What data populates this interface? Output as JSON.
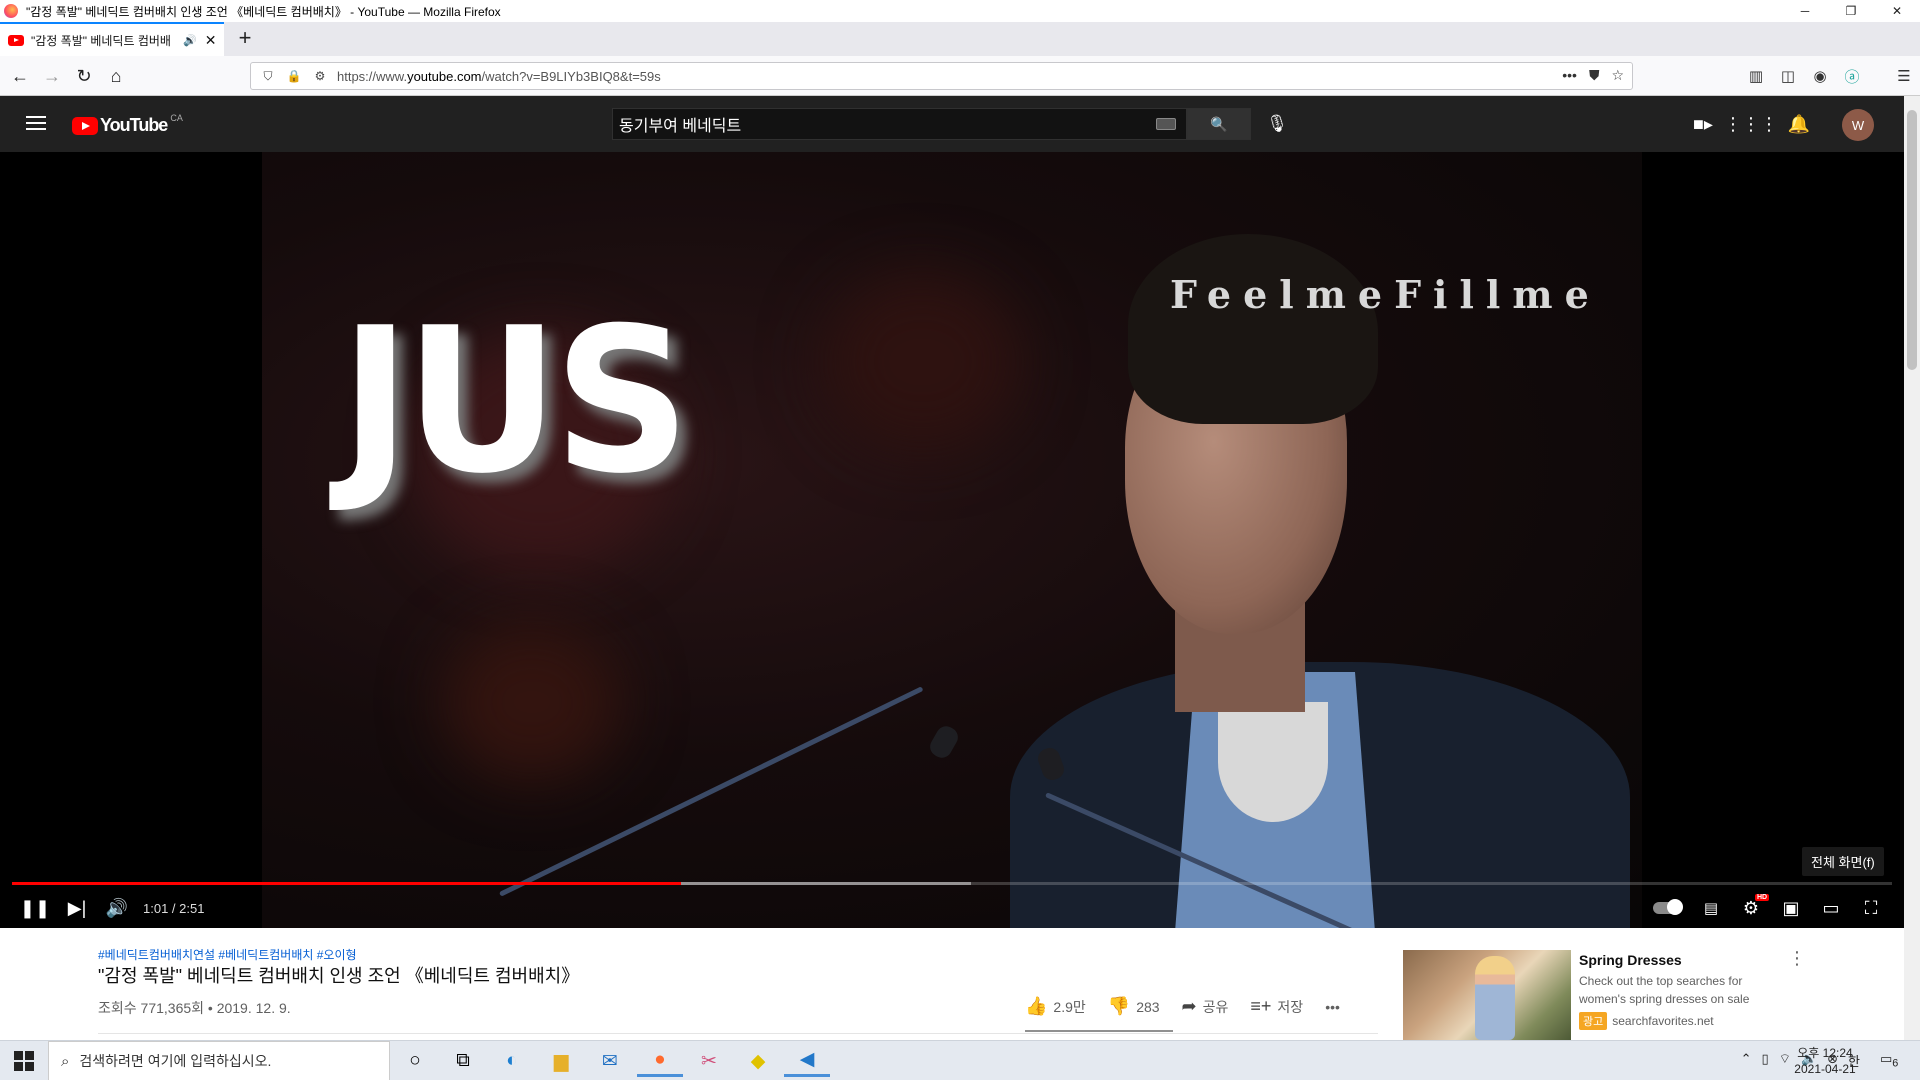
{
  "window": {
    "title": "\"감정 폭발\" 베네딕트 컴버배치 인생 조언 《베네딕트 컴버배치》 - YouTube — Mozilla Firefox",
    "minimize": "─",
    "maximize": "❐",
    "close": "✕"
  },
  "tab": {
    "title": "\"감정 폭발\" 베네딕트 컴버배",
    "close": "✕",
    "new_tab": "+"
  },
  "nav": {
    "url_prefix": "https://www.",
    "url_domain": "youtube.com",
    "url_suffix": "/watch?v=B9LIYb3BIQ8&t=59s"
  },
  "youtube": {
    "logo_text": "YouTube",
    "country": "CA",
    "search_value": "동기부여 베네딕트",
    "avatar_letter": "W"
  },
  "player": {
    "overlay_text": "JUS",
    "watermark": "FeelmeFillme",
    "current_time": "1:01",
    "duration": "2:51",
    "time_display": "1:01 / 2:51",
    "fullscreen_tooltip": "전체 화면(f)",
    "played_fraction": 0.356,
    "buffered_fraction": 0.51,
    "hd_badge": "HD"
  },
  "video": {
    "hashtags": "#베네딕트컴버배치연설 #베네딕트컴버배치 #오이형",
    "title": "\"감정 폭발\" 베네딕트 컴버배치 인생 조언 《베네딕트 컴버배치》",
    "meta": "조회수 771,365회 • 2019. 12. 9.",
    "likes": "2.9만",
    "dislikes": "283",
    "share": "공유",
    "save": "저장",
    "more": "•••"
  },
  "ad": {
    "title": "Spring Dresses",
    "description": "Check out the top searches for women's spring dresses on sale",
    "badge": "광고",
    "domain": "searchfavorites.net"
  },
  "taskbar": {
    "search_placeholder": "검색하려면 여기에 입력하십시오.",
    "ime": "한",
    "clock_time": "오후 12:24",
    "clock_date": "2021-04-21",
    "notification_count": "6"
  },
  "colors": {
    "yt_red": "#ff0000",
    "yt_dark": "#212121",
    "link_blue": "#065fd4",
    "ad_badge": "#f5a623"
  }
}
